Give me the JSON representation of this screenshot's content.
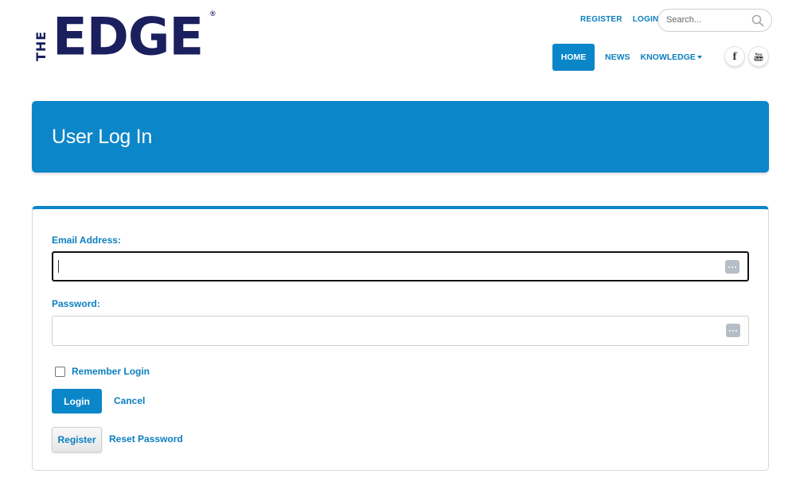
{
  "logo": {
    "the": "THE",
    "edge": "EDGE",
    "registered": "®"
  },
  "top_links": {
    "register": "REGISTER",
    "login": "LOGIN"
  },
  "search": {
    "placeholder": "Search..."
  },
  "nav": {
    "home": "HOME",
    "news": "NEWS",
    "knowledge": "KNOWLEDGE"
  },
  "social": {
    "facebook": "f",
    "youtube": "You Tube"
  },
  "banner": {
    "title": "User Log In"
  },
  "form": {
    "email_label": "Email Address:",
    "email_value": "",
    "password_label": "Password:",
    "password_value": "",
    "remember_label": "Remember Login",
    "remember_checked": false,
    "login_button": "Login",
    "cancel_link": "Cancel",
    "register_button": "Register",
    "reset_link": "Reset Password"
  },
  "colors": {
    "brand_blue": "#0b86c9",
    "logo_navy": "#1a1f5e"
  },
  "icons": [
    "search-icon",
    "facebook-icon",
    "youtube-icon",
    "password-manager-icon"
  ]
}
